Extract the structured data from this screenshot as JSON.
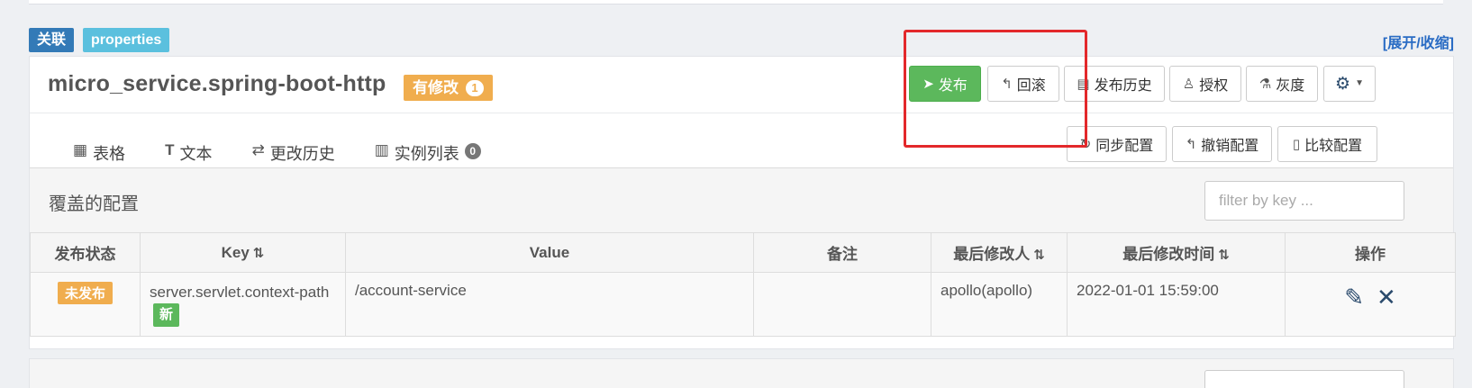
{
  "tags": {
    "link": "关联",
    "format": "properties"
  },
  "toggle_link": "[展开/收缩]",
  "namespace": {
    "title": "micro_service.spring-boot-http",
    "modified_label": "有修改",
    "modified_count": "1"
  },
  "toolbar": {
    "publish": "发布",
    "rollback": "回滚",
    "publish_history": "发布历史",
    "authorize": "授权",
    "gray": "灰度",
    "sync": "同步配置",
    "revoke": "撤销配置",
    "compare": "比较配置"
  },
  "tabs": [
    {
      "label": "表格",
      "icon": "table-icon"
    },
    {
      "label": "文本",
      "icon": "text-icon"
    },
    {
      "label": "更改历史",
      "icon": "history-icon"
    },
    {
      "label": "实例列表",
      "icon": "instance-icon",
      "count": "0"
    }
  ],
  "override": {
    "title": "覆盖的配置",
    "filter_placeholder": "filter by key ..."
  },
  "table": {
    "headers": [
      "发布状态",
      "Key",
      "Value",
      "备注",
      "最后修改人",
      "最后修改时间",
      "操作"
    ],
    "rows": [
      {
        "status": "未发布",
        "key": "server.servlet.context-path",
        "key_badge": "新",
        "value": "/account-service",
        "comment": "",
        "modifier": "apollo(apollo)",
        "modified_time": "2022-01-01 15:59:00"
      }
    ]
  },
  "colors": {
    "primary": "#337ab7",
    "info": "#5bc0de",
    "success": "#5cb85c",
    "warning": "#f0ad4e",
    "highlight": "#e3282b"
  }
}
